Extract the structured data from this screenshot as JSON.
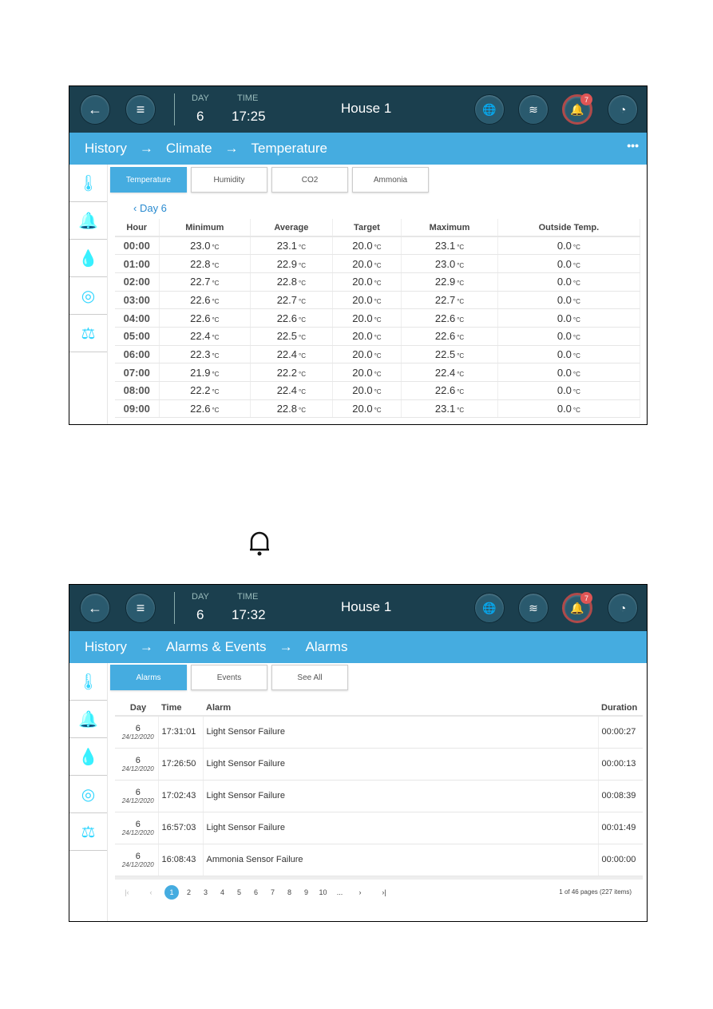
{
  "screen1": {
    "header": {
      "day_label": "DAY",
      "day": "6",
      "time_label": "TIME",
      "time": "17:25",
      "house": "House 1",
      "alarm_count": "7"
    },
    "breadcrumb": [
      "History",
      "Climate",
      "Temperature"
    ],
    "tabs": [
      "Temperature",
      "Humidity",
      "CO2",
      "Ammonia"
    ],
    "active_tab": "Temperature",
    "day_nav": "Day 6",
    "unit": "°C",
    "columns": [
      "Hour",
      "Minimum",
      "Average",
      "Target",
      "Maximum",
      "Outside Temp."
    ],
    "rows": [
      [
        "00:00",
        "23.0",
        "23.1",
        "20.0",
        "23.1",
        "0.0"
      ],
      [
        "01:00",
        "22.8",
        "22.9",
        "20.0",
        "23.0",
        "0.0"
      ],
      [
        "02:00",
        "22.7",
        "22.8",
        "20.0",
        "22.9",
        "0.0"
      ],
      [
        "03:00",
        "22.6",
        "22.7",
        "20.0",
        "22.7",
        "0.0"
      ],
      [
        "04:00",
        "22.6",
        "22.6",
        "20.0",
        "22.6",
        "0.0"
      ],
      [
        "05:00",
        "22.4",
        "22.5",
        "20.0",
        "22.6",
        "0.0"
      ],
      [
        "06:00",
        "22.3",
        "22.4",
        "20.0",
        "22.5",
        "0.0"
      ],
      [
        "07:00",
        "21.9",
        "22.2",
        "20.0",
        "22.4",
        "0.0"
      ],
      [
        "08:00",
        "22.2",
        "22.4",
        "20.0",
        "22.6",
        "0.0"
      ],
      [
        "09:00",
        "22.6",
        "22.8",
        "20.0",
        "23.1",
        "0.0"
      ]
    ]
  },
  "screen2": {
    "header": {
      "day_label": "DAY",
      "day": "6",
      "time_label": "TIME",
      "time": "17:32",
      "house": "House 1",
      "alarm_count": "7"
    },
    "breadcrumb": [
      "History",
      "Alarms & Events",
      "Alarms"
    ],
    "tabs": [
      "Alarms",
      "Events",
      "See All"
    ],
    "active_tab": "Alarms",
    "columns": [
      "Day",
      "Time",
      "Alarm",
      "Duration"
    ],
    "rows": [
      [
        "6",
        "24/12/2020",
        "17:31:01",
        "Light Sensor Failure",
        "00:00:27"
      ],
      [
        "6",
        "24/12/2020",
        "17:26:50",
        "Light Sensor Failure",
        "00:00:13"
      ],
      [
        "6",
        "24/12/2020",
        "17:02:43",
        "Light Sensor Failure",
        "00:08:39"
      ],
      [
        "6",
        "24/12/2020",
        "16:57:03",
        "Light Sensor Failure",
        "00:01:49"
      ],
      [
        "6",
        "24/12/2020",
        "16:08:43",
        "Ammonia Sensor Failure",
        "00:00:00"
      ]
    ],
    "pages": [
      "1",
      "2",
      "3",
      "4",
      "5",
      "6",
      "7",
      "8",
      "9",
      "10",
      "..."
    ],
    "current_page": "1",
    "page_info": "1 of 46 pages (227 items)"
  },
  "colors": {
    "header": "#1b3f4e",
    "accent": "#45ace0",
    "badge": "#e05555"
  },
  "icons": {
    "middle": "bell-icon"
  }
}
